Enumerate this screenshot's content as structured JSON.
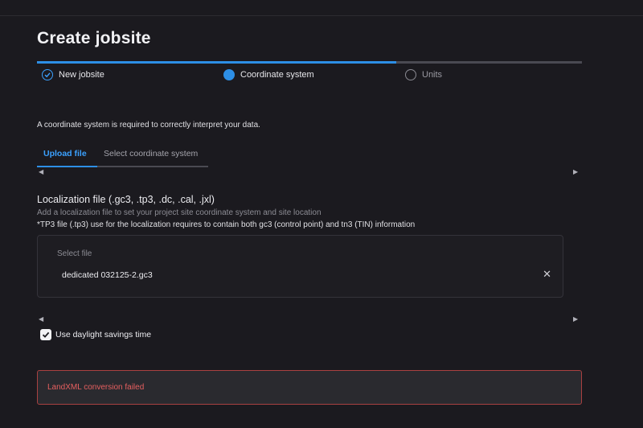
{
  "page": {
    "title": "Create jobsite"
  },
  "stepper": {
    "progress_percent": 66,
    "steps": [
      {
        "label": "New jobsite",
        "state": "done"
      },
      {
        "label": "Coordinate system",
        "state": "current"
      },
      {
        "label": "Units",
        "state": "pending"
      }
    ]
  },
  "intro_text": "A coordinate system is required to correctly interpret your data.",
  "tabs": [
    {
      "label": "Upload file",
      "active": true
    },
    {
      "label": "Select coordinate system",
      "active": false
    }
  ],
  "localization": {
    "title": "Localization file (.gc3, .tp3, .dc, .cal, .jxl)",
    "subtitle": "Add a localization file to set your project site coordinate system and site location",
    "note": "*TP3 file (.tp3) use for the localization requires to contain both gc3 (control point) and tn3 (TIN) information",
    "select_file_label": "Select file",
    "file_name": "dedicated 032125-2.gc3"
  },
  "daylight_savings": {
    "label": "Use daylight savings time",
    "checked": true
  },
  "error": {
    "message": "LandXML conversion failed"
  },
  "colors": {
    "accent": "#2d8fe6",
    "error": "#e65f5f",
    "background": "#1b1a1f"
  }
}
